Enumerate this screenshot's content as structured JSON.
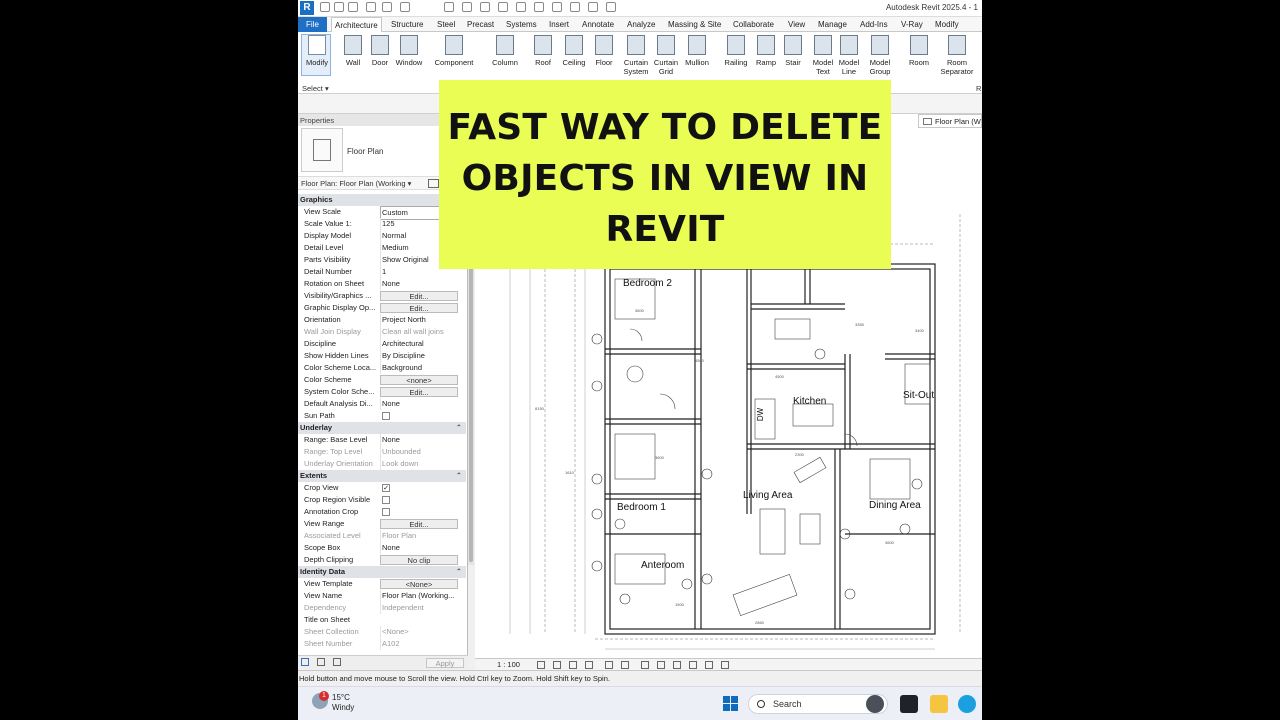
{
  "app": {
    "title": "Autodesk Revit 2025.4 - 1",
    "logo": "R"
  },
  "tabs": [
    "File",
    "Architecture",
    "Structure",
    "Steel",
    "Precast",
    "Systems",
    "Insert",
    "Annotate",
    "Analyze",
    "Massing & Site",
    "Collaborate",
    "View",
    "Manage",
    "Add-Ins",
    "V-Ray",
    "Modify"
  ],
  "ribbon": {
    "tools": [
      {
        "l1": "Modify",
        "l2": ""
      },
      {
        "l1": "Wall",
        "l2": ""
      },
      {
        "l1": "Door",
        "l2": ""
      },
      {
        "l1": "Window",
        "l2": ""
      },
      {
        "l1": "Component",
        "l2": ""
      },
      {
        "l1": "Column",
        "l2": ""
      },
      {
        "l1": "Roof",
        "l2": ""
      },
      {
        "l1": "Ceiling",
        "l2": ""
      },
      {
        "l1": "Floor",
        "l2": ""
      },
      {
        "l1": "Curtain",
        "l2": "System"
      },
      {
        "l1": "Curtain",
        "l2": "Grid"
      },
      {
        "l1": "Mullion",
        "l2": ""
      },
      {
        "l1": "Railing",
        "l2": ""
      },
      {
        "l1": "Ramp",
        "l2": ""
      },
      {
        "l1": "Stair",
        "l2": ""
      },
      {
        "l1": "Model",
        "l2": "Text"
      },
      {
        "l1": "Model",
        "l2": "Line"
      },
      {
        "l1": "Model",
        "l2": "Group"
      },
      {
        "l1": "Room",
        "l2": ""
      },
      {
        "l1": "Room",
        "l2": "Separator"
      }
    ],
    "select_label": "Select",
    "right_label": "R"
  },
  "properties": {
    "header": "Properties",
    "type_name": "Floor Plan",
    "instance_selector": "Floor Plan: Floor Plan (Working",
    "rows": [
      {
        "kind": "group",
        "k": "Graphics"
      },
      {
        "kind": "text",
        "k": "View Scale",
        "v": "Custom",
        "boxed": true
      },
      {
        "kind": "text",
        "k": "Scale Value   1:",
        "v": "125"
      },
      {
        "kind": "text",
        "k": "Display Model",
        "v": "Normal"
      },
      {
        "kind": "text",
        "k": "Detail Level",
        "v": "Medium"
      },
      {
        "kind": "text",
        "k": "Parts Visibility",
        "v": "Show Original"
      },
      {
        "kind": "text",
        "k": "Detail Number",
        "v": "1"
      },
      {
        "kind": "text",
        "k": "Rotation on Sheet",
        "v": "None"
      },
      {
        "kind": "button",
        "k": "Visibility/Graphics ...",
        "v": "Edit..."
      },
      {
        "kind": "button",
        "k": "Graphic Display Op...",
        "v": "Edit..."
      },
      {
        "kind": "text",
        "k": "Orientation",
        "v": "Project North"
      },
      {
        "kind": "dim",
        "k": "Wall Join Display",
        "v": "Clean all wall joins"
      },
      {
        "kind": "text",
        "k": "Discipline",
        "v": "Architectural"
      },
      {
        "kind": "text",
        "k": "Show Hidden Lines",
        "v": "By Discipline"
      },
      {
        "kind": "text",
        "k": "Color Scheme Loca...",
        "v": "Background"
      },
      {
        "kind": "button",
        "k": "Color Scheme",
        "v": "<none>"
      },
      {
        "kind": "button",
        "k": "System Color Sche...",
        "v": "Edit..."
      },
      {
        "kind": "text",
        "k": "Default Analysis Di...",
        "v": "None"
      },
      {
        "kind": "check",
        "k": "Sun Path",
        "v": ""
      },
      {
        "kind": "group",
        "k": "Underlay"
      },
      {
        "kind": "text",
        "k": "Range: Base Level",
        "v": "None"
      },
      {
        "kind": "dim",
        "k": "Range: Top Level",
        "v": "Unbounded"
      },
      {
        "kind": "dim",
        "k": "Underlay Orientation",
        "v": "Look down"
      },
      {
        "kind": "group",
        "k": "Extents"
      },
      {
        "kind": "check",
        "k": "Crop View",
        "v": "✓"
      },
      {
        "kind": "check",
        "k": "Crop Region Visible",
        "v": ""
      },
      {
        "kind": "check",
        "k": "Annotation Crop",
        "v": ""
      },
      {
        "kind": "button",
        "k": "View Range",
        "v": "Edit..."
      },
      {
        "kind": "dim",
        "k": "Associated Level",
        "v": "Floor Plan"
      },
      {
        "kind": "text",
        "k": "Scope Box",
        "v": "None"
      },
      {
        "kind": "button",
        "k": "Depth Clipping",
        "v": "No clip"
      },
      {
        "kind": "group",
        "k": "Identity Data"
      },
      {
        "kind": "button",
        "k": "View Template",
        "v": "<None>"
      },
      {
        "kind": "text",
        "k": "View Name",
        "v": "Floor Plan (Working..."
      },
      {
        "kind": "dim",
        "k": "Dependency",
        "v": "Independent"
      },
      {
        "kind": "text",
        "k": "Title on Sheet",
        "v": ""
      },
      {
        "kind": "dim",
        "k": "Sheet Collection",
        "v": "<None>"
      },
      {
        "kind": "dim",
        "k": "Sheet Number",
        "v": "A102"
      }
    ],
    "apply_label": "Apply"
  },
  "view": {
    "tab_label": "Floor Plan (W",
    "scale_label": "1 : 100",
    "rooms": [
      "Bedroom 2",
      "Kitchen",
      "Sit-Out",
      "Living Area",
      "Dining Area",
      "Bedroom 1",
      "Anteroom",
      "DW"
    ]
  },
  "status_text": "Hold button and move mouse to Scroll the view. Hold Ctrl key to Zoom. Hold Shift key to Spin.",
  "taskbar": {
    "temperature": "15°C",
    "condition": "Windy",
    "badge": "1",
    "search_label": "Search"
  },
  "overlay": {
    "lines": [
      "FAST WAY TO DELETE",
      "OBJECTS IN VIEW IN",
      "REVIT"
    ]
  }
}
